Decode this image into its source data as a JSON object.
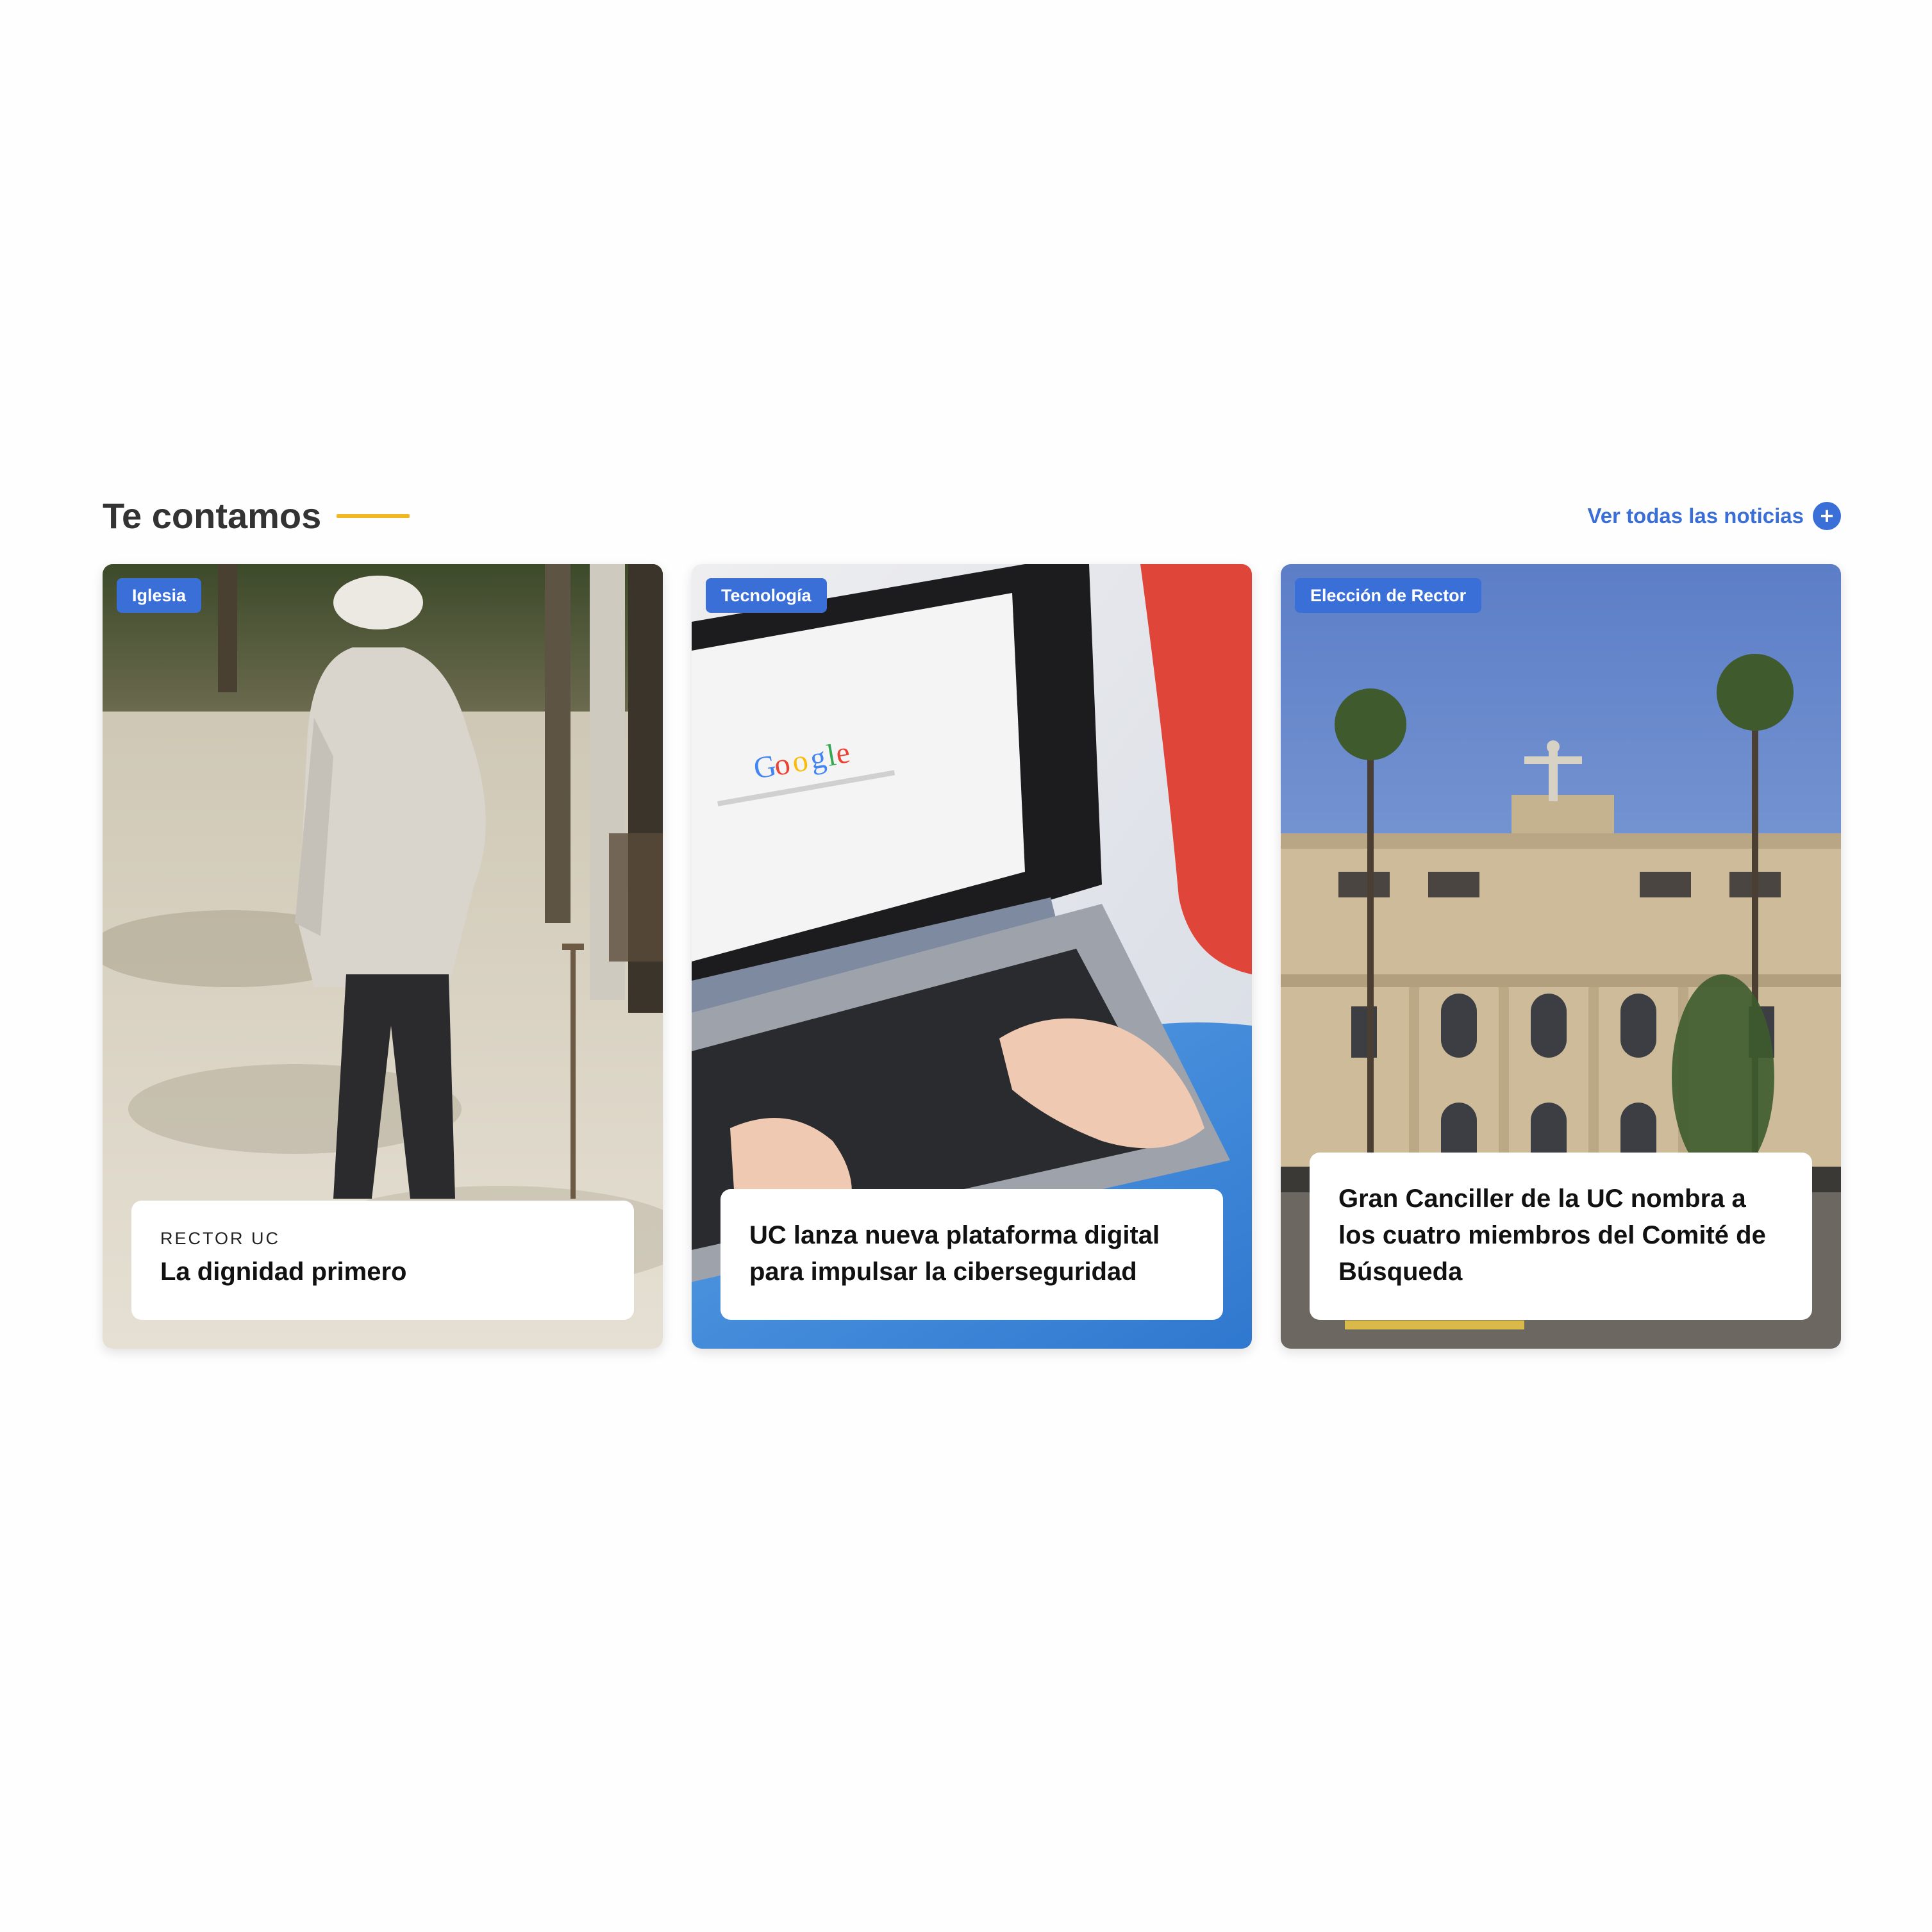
{
  "section": {
    "title": "Te contamos",
    "see_all_label": "Ver todas las noticias",
    "see_all_icon": "plus-icon"
  },
  "colors": {
    "accent_blue": "#3a6fd8",
    "accent_yellow": "#f1b81f",
    "title_gray": "#333333"
  },
  "cards": [
    {
      "category": "Iglesia",
      "kicker": "RECTOR UC",
      "headline": "La dignidad primero",
      "image": "elderly man walking with cane in park"
    },
    {
      "category": "Tecnología",
      "kicker": "",
      "headline": "UC lanza nueva plataforma digital para impulsar la ciberseguridad",
      "image": "hands typing on laptop showing Google"
    },
    {
      "category": "Elección de Rector",
      "kicker": "",
      "headline": "Gran Canciller de la UC nombra a los cuatro miembros del Comité de Búsqueda",
      "image": "university main building with statue and palm trees"
    }
  ]
}
